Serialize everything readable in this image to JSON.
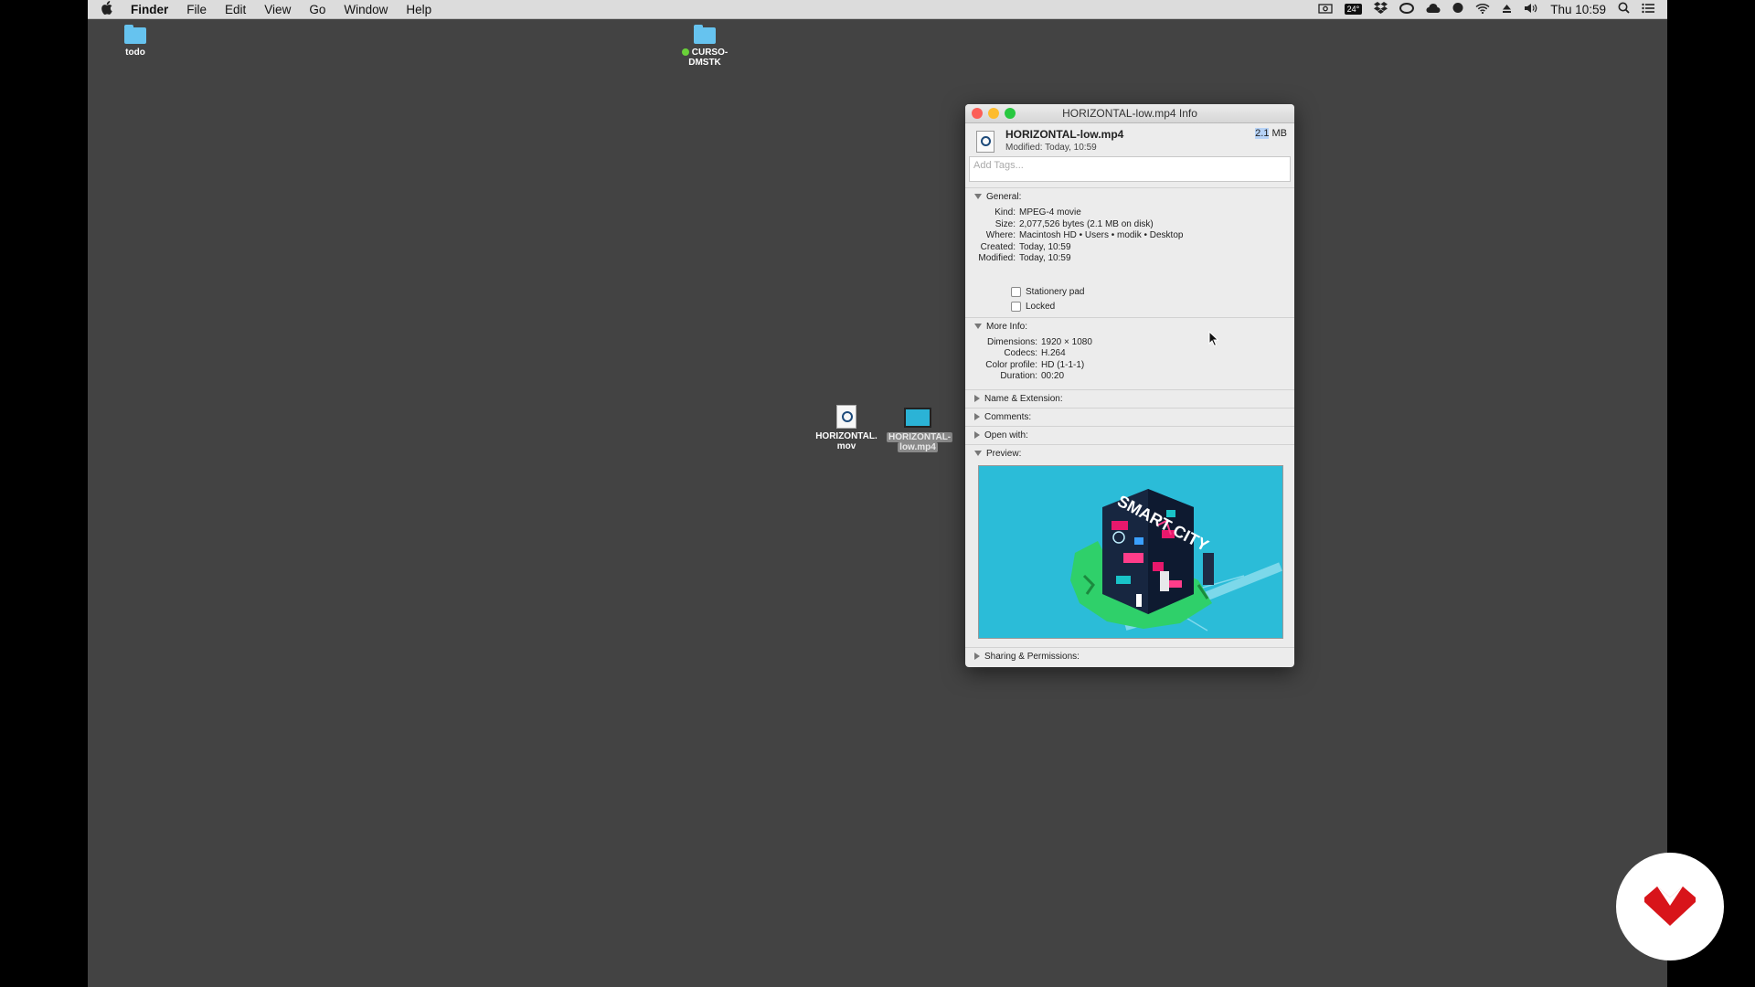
{
  "menubar": {
    "app": "Finder",
    "items": [
      "File",
      "Edit",
      "View",
      "Go",
      "Window",
      "Help"
    ],
    "temp": "24°",
    "clock": "Thu 10:59"
  },
  "desktop": {
    "todo": "todo",
    "curso_line1": "CURSO-",
    "curso_line2": "DMSTK",
    "mov_line1": "HORIZONTAL.",
    "mov_line2": "mov",
    "mp4_line1": "HORIZONTAL-",
    "mp4_line2": "low.mp4"
  },
  "info": {
    "title": "HORIZONTAL-low.mp4 Info",
    "filename": "HORIZONTAL-low.mp4",
    "modified_header": "Modified: Today, 10:59",
    "size_num": "2.1",
    "size_unit": " MB",
    "tags_placeholder": "Add Tags...",
    "general_label": "General:",
    "general": [
      {
        "k": "Kind:",
        "v": "MPEG-4 movie"
      },
      {
        "k": "Size:",
        "v": "2,077,526 bytes (2.1 MB on disk)"
      },
      {
        "k": "Where:",
        "v": "Macintosh HD • Users • modik • Desktop"
      },
      {
        "k": "Created:",
        "v": "Today, 10:59"
      },
      {
        "k": "Modified:",
        "v": "Today, 10:59"
      }
    ],
    "stationery": "Stationery pad",
    "locked": "Locked",
    "more_label": "More Info:",
    "more": [
      {
        "k": "Dimensions:",
        "v": "1920 × 1080"
      },
      {
        "k": "Codecs:",
        "v": "H.264"
      },
      {
        "k": "Color profile:",
        "v": "HD (1-1-1)"
      },
      {
        "k": "Duration:",
        "v": "00:20"
      }
    ],
    "name_ext": "Name & Extension:",
    "comments": "Comments:",
    "open_with": "Open with:",
    "preview": "Preview:",
    "preview_text": "SMART CITY",
    "sharing": "Sharing & Permissions:"
  },
  "colors": {
    "desktop": "#434343",
    "preview_bg": "#2bbcd8",
    "logo": "#d8141a"
  }
}
